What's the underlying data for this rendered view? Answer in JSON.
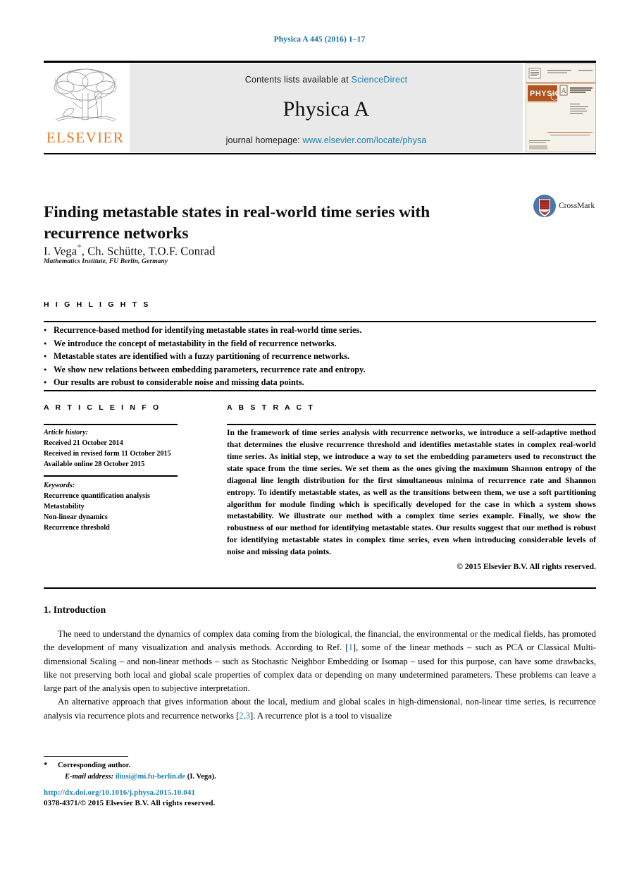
{
  "running_head": "Physica A 445 (2016) 1–17",
  "masthead": {
    "publisher_logo_name": "elsevier-tree-logo",
    "publisher_wordmark": "ELSEVIER",
    "contents_prefix": "Contents lists available at",
    "contents_link": "ScienceDirect",
    "journal_name": "Physica A",
    "homepage_prefix": "journal homepage:",
    "homepage_url": "www.elsevier.com/locate/physa",
    "cover": {
      "brand": "PHYSICA",
      "volume_letter": "A",
      "subtitle": "STATISTICAL MECHANICS AND ITS APPLICATIONS",
      "publisher_footer": "ELSEVIER"
    }
  },
  "article": {
    "title": "Finding metastable states in real-world time series with recurrence networks",
    "authors": "I. Vega",
    "authors_rest": ", Ch. Schütte, T.O.F. Conrad",
    "corresponding_marker": "*",
    "affiliation": "Mathematics Institute, FU Berlin, Germany",
    "crossmark_label": "CrossMark"
  },
  "highlights": {
    "label": "H I G H L I G H T S",
    "items": [
      "Recurrence-based method for identifying metastable states in real-world time series.",
      "We introduce the concept of metastability in the field of recurrence networks.",
      "Metastable states are identified with a fuzzy partitioning of recurrence networks.",
      "We show new relations between embedding parameters, recurrence rate and entropy.",
      "Our results are robust to considerable noise and missing data points."
    ]
  },
  "article_info": {
    "label": "A R T I C L E    I N F O",
    "history_title": "Article history:",
    "history": [
      "Received 21 October 2014",
      "Received in revised form 11 October 2015",
      "Available online 28 October 2015"
    ],
    "keywords_title": "Keywords:",
    "keywords": [
      "Recurrence quantification analysis",
      "Metastability",
      "Non-linear dynamics",
      "Recurrence threshold"
    ]
  },
  "abstract": {
    "label": "A B S T R A C T",
    "text": "In the framework of time series analysis with recurrence networks, we introduce a self-adaptive method that determines the elusive recurrence threshold and identifies metastable states in complex real-world time series. As initial step, we introduce a way to set the embedding parameters used to reconstruct the state space from the time series. We set them as the ones giving the maximum Shannon entropy of the diagonal line length distribution for the first simultaneous minima of recurrence rate and Shannon entropy. To identify metastable states, as well as the transitions between them, we use a soft partitioning algorithm for module finding which is specifically developed for the case in which a system shows metastability. We illustrate our method with a complex time series example. Finally, we show the robustness of our method for identifying metastable states. Our results suggest that our method is robust for identifying metastable states in complex time series, even when introducing considerable levels of noise and missing data points.",
    "copyright": "© 2015 Elsevier B.V. All rights reserved."
  },
  "body": {
    "section_heading": "1. Introduction",
    "paragraph1_a": "The need to understand the dynamics of complex data coming from the biological, the financial, the environmental or the medical fields, has promoted the development of many visualization and analysis methods. According to Ref. [",
    "paragraph1_ref": "1",
    "paragraph1_b": "], some of the linear methods – such as PCA or Classical Multi-dimensional Scaling – and non-linear methods – such as Stochastic Neighbor Embedding or Isomap – used for this purpose, can have some drawbacks, like not preserving both local and global scale properties of complex data or depending on many undetermined parameters. These problems can leave a large part of the analysis open to subjective interpretation.",
    "paragraph2_a": "An alternative approach that gives information about the local, medium and global scales in high-dimensional, non-linear time series, is recurrence analysis via recurrence plots and recurrence networks [",
    "paragraph2_ref": "2,3",
    "paragraph2_b": "]. A recurrence plot is a tool to visualize"
  },
  "footer": {
    "corresponding_star": "*",
    "corresponding_text": "Corresponding author.",
    "email_label": "E-mail address:",
    "email": "iliusi@mi.fu-berlin.de",
    "email_owner": "(I. Vega).",
    "doi": "http://dx.doi.org/10.1016/j.physa.2015.10.041",
    "issn": "0378-4371/© 2015 Elsevier B.V. All rights reserved."
  },
  "colors": {
    "link_blue": "#1b7fb5",
    "elsevier_orange": "#e87722",
    "band_gray": "#e9e9e9"
  }
}
